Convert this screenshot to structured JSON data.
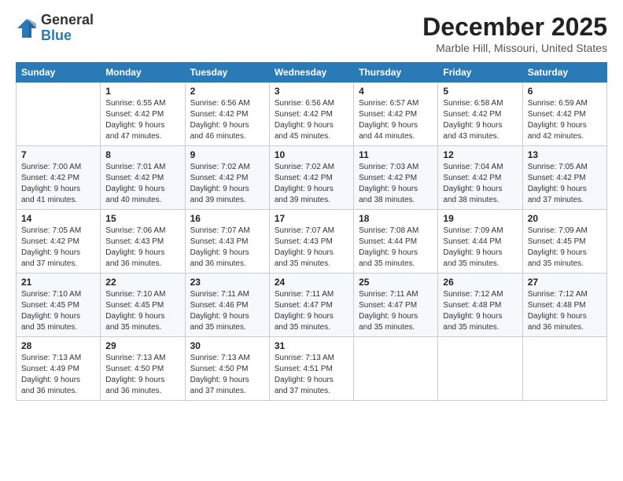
{
  "header": {
    "logo": {
      "general": "General",
      "blue": "Blue"
    },
    "title": "December 2025",
    "location": "Marble Hill, Missouri, United States"
  },
  "weekdays": [
    "Sunday",
    "Monday",
    "Tuesday",
    "Wednesday",
    "Thursday",
    "Friday",
    "Saturday"
  ],
  "weeks": [
    [
      {
        "day": "",
        "info": ""
      },
      {
        "day": "1",
        "info": "Sunrise: 6:55 AM\nSunset: 4:42 PM\nDaylight: 9 hours\nand 47 minutes."
      },
      {
        "day": "2",
        "info": "Sunrise: 6:56 AM\nSunset: 4:42 PM\nDaylight: 9 hours\nand 46 minutes."
      },
      {
        "day": "3",
        "info": "Sunrise: 6:56 AM\nSunset: 4:42 PM\nDaylight: 9 hours\nand 45 minutes."
      },
      {
        "day": "4",
        "info": "Sunrise: 6:57 AM\nSunset: 4:42 PM\nDaylight: 9 hours\nand 44 minutes."
      },
      {
        "day": "5",
        "info": "Sunrise: 6:58 AM\nSunset: 4:42 PM\nDaylight: 9 hours\nand 43 minutes."
      },
      {
        "day": "6",
        "info": "Sunrise: 6:59 AM\nSunset: 4:42 PM\nDaylight: 9 hours\nand 42 minutes."
      }
    ],
    [
      {
        "day": "7",
        "info": "Sunrise: 7:00 AM\nSunset: 4:42 PM\nDaylight: 9 hours\nand 41 minutes."
      },
      {
        "day": "8",
        "info": "Sunrise: 7:01 AM\nSunset: 4:42 PM\nDaylight: 9 hours\nand 40 minutes."
      },
      {
        "day": "9",
        "info": "Sunrise: 7:02 AM\nSunset: 4:42 PM\nDaylight: 9 hours\nand 39 minutes."
      },
      {
        "day": "10",
        "info": "Sunrise: 7:02 AM\nSunset: 4:42 PM\nDaylight: 9 hours\nand 39 minutes."
      },
      {
        "day": "11",
        "info": "Sunrise: 7:03 AM\nSunset: 4:42 PM\nDaylight: 9 hours\nand 38 minutes."
      },
      {
        "day": "12",
        "info": "Sunrise: 7:04 AM\nSunset: 4:42 PM\nDaylight: 9 hours\nand 38 minutes."
      },
      {
        "day": "13",
        "info": "Sunrise: 7:05 AM\nSunset: 4:42 PM\nDaylight: 9 hours\nand 37 minutes."
      }
    ],
    [
      {
        "day": "14",
        "info": "Sunrise: 7:05 AM\nSunset: 4:42 PM\nDaylight: 9 hours\nand 37 minutes."
      },
      {
        "day": "15",
        "info": "Sunrise: 7:06 AM\nSunset: 4:43 PM\nDaylight: 9 hours\nand 36 minutes."
      },
      {
        "day": "16",
        "info": "Sunrise: 7:07 AM\nSunset: 4:43 PM\nDaylight: 9 hours\nand 36 minutes."
      },
      {
        "day": "17",
        "info": "Sunrise: 7:07 AM\nSunset: 4:43 PM\nDaylight: 9 hours\nand 35 minutes."
      },
      {
        "day": "18",
        "info": "Sunrise: 7:08 AM\nSunset: 4:44 PM\nDaylight: 9 hours\nand 35 minutes."
      },
      {
        "day": "19",
        "info": "Sunrise: 7:09 AM\nSunset: 4:44 PM\nDaylight: 9 hours\nand 35 minutes."
      },
      {
        "day": "20",
        "info": "Sunrise: 7:09 AM\nSunset: 4:45 PM\nDaylight: 9 hours\nand 35 minutes."
      }
    ],
    [
      {
        "day": "21",
        "info": "Sunrise: 7:10 AM\nSunset: 4:45 PM\nDaylight: 9 hours\nand 35 minutes."
      },
      {
        "day": "22",
        "info": "Sunrise: 7:10 AM\nSunset: 4:45 PM\nDaylight: 9 hours\nand 35 minutes."
      },
      {
        "day": "23",
        "info": "Sunrise: 7:11 AM\nSunset: 4:46 PM\nDaylight: 9 hours\nand 35 minutes."
      },
      {
        "day": "24",
        "info": "Sunrise: 7:11 AM\nSunset: 4:47 PM\nDaylight: 9 hours\nand 35 minutes."
      },
      {
        "day": "25",
        "info": "Sunrise: 7:11 AM\nSunset: 4:47 PM\nDaylight: 9 hours\nand 35 minutes."
      },
      {
        "day": "26",
        "info": "Sunrise: 7:12 AM\nSunset: 4:48 PM\nDaylight: 9 hours\nand 35 minutes."
      },
      {
        "day": "27",
        "info": "Sunrise: 7:12 AM\nSunset: 4:48 PM\nDaylight: 9 hours\nand 36 minutes."
      }
    ],
    [
      {
        "day": "28",
        "info": "Sunrise: 7:13 AM\nSunset: 4:49 PM\nDaylight: 9 hours\nand 36 minutes."
      },
      {
        "day": "29",
        "info": "Sunrise: 7:13 AM\nSunset: 4:50 PM\nDaylight: 9 hours\nand 36 minutes."
      },
      {
        "day": "30",
        "info": "Sunrise: 7:13 AM\nSunset: 4:50 PM\nDaylight: 9 hours\nand 37 minutes."
      },
      {
        "day": "31",
        "info": "Sunrise: 7:13 AM\nSunset: 4:51 PM\nDaylight: 9 hours\nand 37 minutes."
      },
      {
        "day": "",
        "info": ""
      },
      {
        "day": "",
        "info": ""
      },
      {
        "day": "",
        "info": ""
      }
    ]
  ]
}
